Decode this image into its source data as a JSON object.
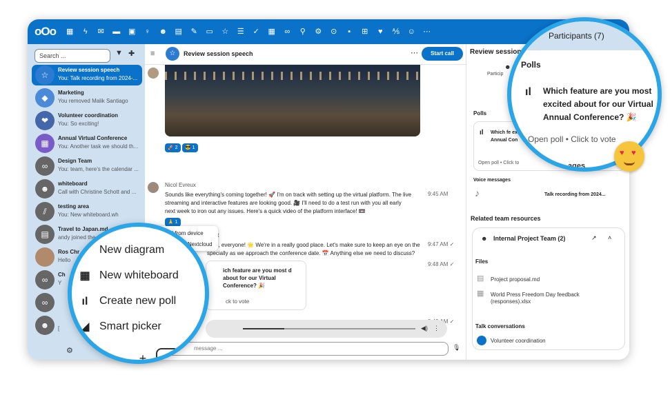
{
  "topbar": {
    "apps": [
      "▦",
      "ϟ",
      "✉",
      "▬",
      "▣",
      "♀",
      "☻",
      "▤",
      "✎",
      "▭",
      "☆",
      "☰",
      "✓",
      "▦",
      "∞",
      "⚲",
      "⚙",
      "⊙",
      "▪",
      "⊞",
      "♥",
      "⅍",
      "☺",
      "⋯"
    ]
  },
  "sidebar": {
    "search_placeholder": "Search ...",
    "conversations": [
      {
        "name": "Review session speech",
        "msg": "You: Talk recording from 2024-...",
        "color": "#2d7bd1",
        "icon": "☆"
      },
      {
        "name": "Marketing",
        "msg": "You removed Malik Santiago",
        "color": "#4a8ad8",
        "icon": "◆"
      },
      {
        "name": "Volunteer coordination",
        "msg": "You: So exciting!",
        "color": "#4466aa",
        "icon": "❤"
      },
      {
        "name": "Annual Virtual Conference",
        "msg": "You: Another task we should th...",
        "color": "#7a5cc8",
        "icon": "▦"
      },
      {
        "name": "Design Team",
        "msg": "You: team, here's the calendar ...",
        "color": "#666",
        "icon": "∞"
      },
      {
        "name": "whiteboard",
        "msg": "Call with Christine Schott and ...",
        "color": "#666",
        "icon": "☻"
      },
      {
        "name": "testing area",
        "msg": "You: New whiteboard.wh",
        "color": "#666",
        "icon": "⫽"
      },
      {
        "name": "Travel to Japan.md",
        "msg": "andy joined the",
        "color": "#666",
        "icon": "▤"
      },
      {
        "name": "Ros Chr",
        "msg": "Hello",
        "color": "#b08a6a",
        "icon": ""
      },
      {
        "name": "Ch",
        "msg": "Y",
        "color": "#666",
        "icon": "∞"
      },
      {
        "name": "",
        "msg": "",
        "color": "#666",
        "icon": "∞"
      },
      {
        "name": "",
        "msg": "[",
        "color": "#666",
        "icon": "☻"
      }
    ]
  },
  "header": {
    "title": "Review session speech",
    "start_call": "Start call"
  },
  "chat": {
    "reactions1": [
      "🚀 2",
      "😎 1"
    ],
    "nicole_name": "Nicol Evreux",
    "nicole_msg": "Sounds like everything's coming together! 🚀 I'm on track with setting up the virtual platform. The live streaming and interactive features are looking good. 🎥 I'll need to do a test run with you all early next week to iron out any issues. Here's a quick video of the platform interface! 📼",
    "nicole_time": "9:45 AM",
    "reaction2": "🙏 1",
    "christine_name": "chott",
    "christine_msg": "astic, everyone! 🌟 We're in a really good place. Let's make sure to keep an eye on the specially as we approach the conference date. 📅 Anything else we need to discuss?",
    "time2": "9:47 AM ✓",
    "time3": "9:48 AM ✓",
    "poll_q": "ich feature are you most d about for our Virtual Conference? 🎉",
    "poll_open": "ck to vote",
    "time4": "9:49 AM ✓",
    "composer_placeholder": "message ...",
    "upload_menu": [
      "Upload from device",
      "Share from Nextcloud"
    ]
  },
  "right": {
    "title": "Review session s",
    "participants": "Particip",
    "polls": "Polls",
    "poll_q": "Which fe excited ab Annual Con",
    "poll_open": "Open poll • Click to",
    "voice": "Voice messages",
    "talk_rec": "Talk recording from 2024...",
    "related": "Related team resources",
    "team": "Internal Project Team (2)",
    "files_label": "Files",
    "files": [
      "Project proposal.md",
      "World Press Freedom Day feedback (responses).xlsx"
    ],
    "talk_label": "Talk conversations",
    "talk_conv": "Volunteer coordination"
  },
  "magnifier_menu": {
    "items": [
      {
        "label": "New diagram",
        "icon": ""
      },
      {
        "label": "New whiteboard",
        "icon": "▦"
      },
      {
        "label": "Create new poll",
        "icon": "ıl"
      },
      {
        "label": "Smart picker",
        "icon": "◢"
      }
    ],
    "plus": "+",
    "emoji": "☺"
  },
  "magnifier_poll": {
    "title": "Participants (7)",
    "polls": "Polls",
    "poll_q": "Which feature are you most excited about for our Virtual Annual Conference? 🎉",
    "poll_open": "Open poll • Click to vote",
    "voice_partial": "ages"
  },
  "colors": {
    "brand": "#0a72c9",
    "ring": "#2aa5e8",
    "sidebar": "#cfe1f1"
  }
}
